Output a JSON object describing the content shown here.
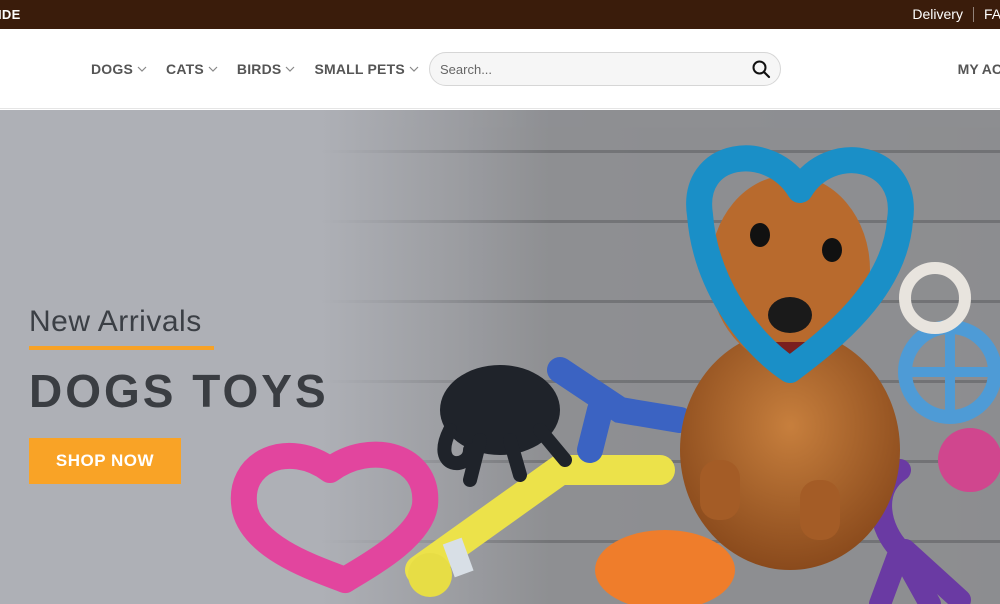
{
  "topbar": {
    "left_text": "IDE",
    "links": [
      "Delivery",
      "FAQ"
    ]
  },
  "nav": {
    "items": [
      {
        "label": "DOGS"
      },
      {
        "label": "CATS"
      },
      {
        "label": "BIRDS"
      },
      {
        "label": "SMALL PETS"
      }
    ]
  },
  "search": {
    "placeholder": "Search...",
    "value": ""
  },
  "account": {
    "label": "MY AC"
  },
  "hero": {
    "subtitle": "New Arrivals",
    "title": "DOGS TOYS",
    "button_label": "SHOP NOW"
  },
  "colors": {
    "topbar_bg": "#3a1c0b",
    "accent": "#f9a326",
    "hero_text": "#3a3d42"
  },
  "icons": {
    "search": "search-icon",
    "nav_chevron": "chevron-down-icon"
  }
}
